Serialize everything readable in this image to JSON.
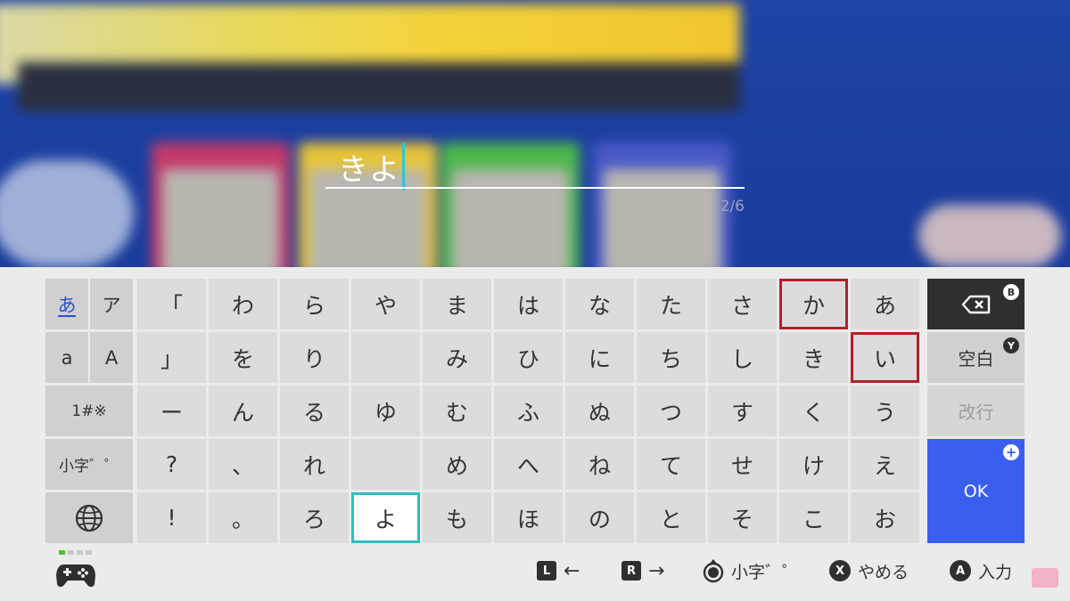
{
  "input": {
    "text": "きよ",
    "counter": "2/6"
  },
  "mode_keys": {
    "hiragana": "あ",
    "katakana": "ア",
    "lower_alpha": "a",
    "upper_alpha": "A",
    "symbols": "1#※",
    "small_dakuten": "小字゛゜"
  },
  "kana_grid": [
    [
      "「",
      "わ",
      "ら",
      "や",
      "ま",
      "は",
      "な",
      "た",
      "さ",
      "か",
      "あ"
    ],
    [
      "」",
      "を",
      "り",
      "",
      "み",
      "ひ",
      "に",
      "ち",
      "し",
      "き",
      "い"
    ],
    [
      "ー",
      "ん",
      "る",
      "ゆ",
      "む",
      "ふ",
      "ぬ",
      "つ",
      "す",
      "く",
      "う"
    ],
    [
      "?",
      "、",
      "れ",
      "",
      "め",
      "へ",
      "ね",
      "て",
      "せ",
      "け",
      "え"
    ],
    [
      "!",
      "。",
      "ろ",
      "よ",
      "も",
      "ほ",
      "の",
      "と",
      "そ",
      "こ",
      "お"
    ]
  ],
  "selected_key": "よ",
  "highlighted_keys": [
    "か",
    "い"
  ],
  "action_keys": {
    "backspace_badge": "B",
    "space_label": "空白",
    "space_badge": "Y",
    "newline_label": "改行",
    "ok_label": "OK",
    "ok_badge": "+"
  },
  "footer": {
    "hint_left_btn": "L",
    "hint_left_arrow": "←",
    "hint_right_btn": "R",
    "hint_right_arrow": "→",
    "hint_small_label": "小字゛゜",
    "hint_cancel_btn": "X",
    "hint_cancel_label": "やめる",
    "hint_input_btn": "A",
    "hint_input_label": "入力"
  },
  "colors": {
    "selected_border": "#2ebebe",
    "highlight_border": "#b41e2a",
    "ok_key": "#3a5ff0",
    "background_blue": "#1f43a6"
  }
}
